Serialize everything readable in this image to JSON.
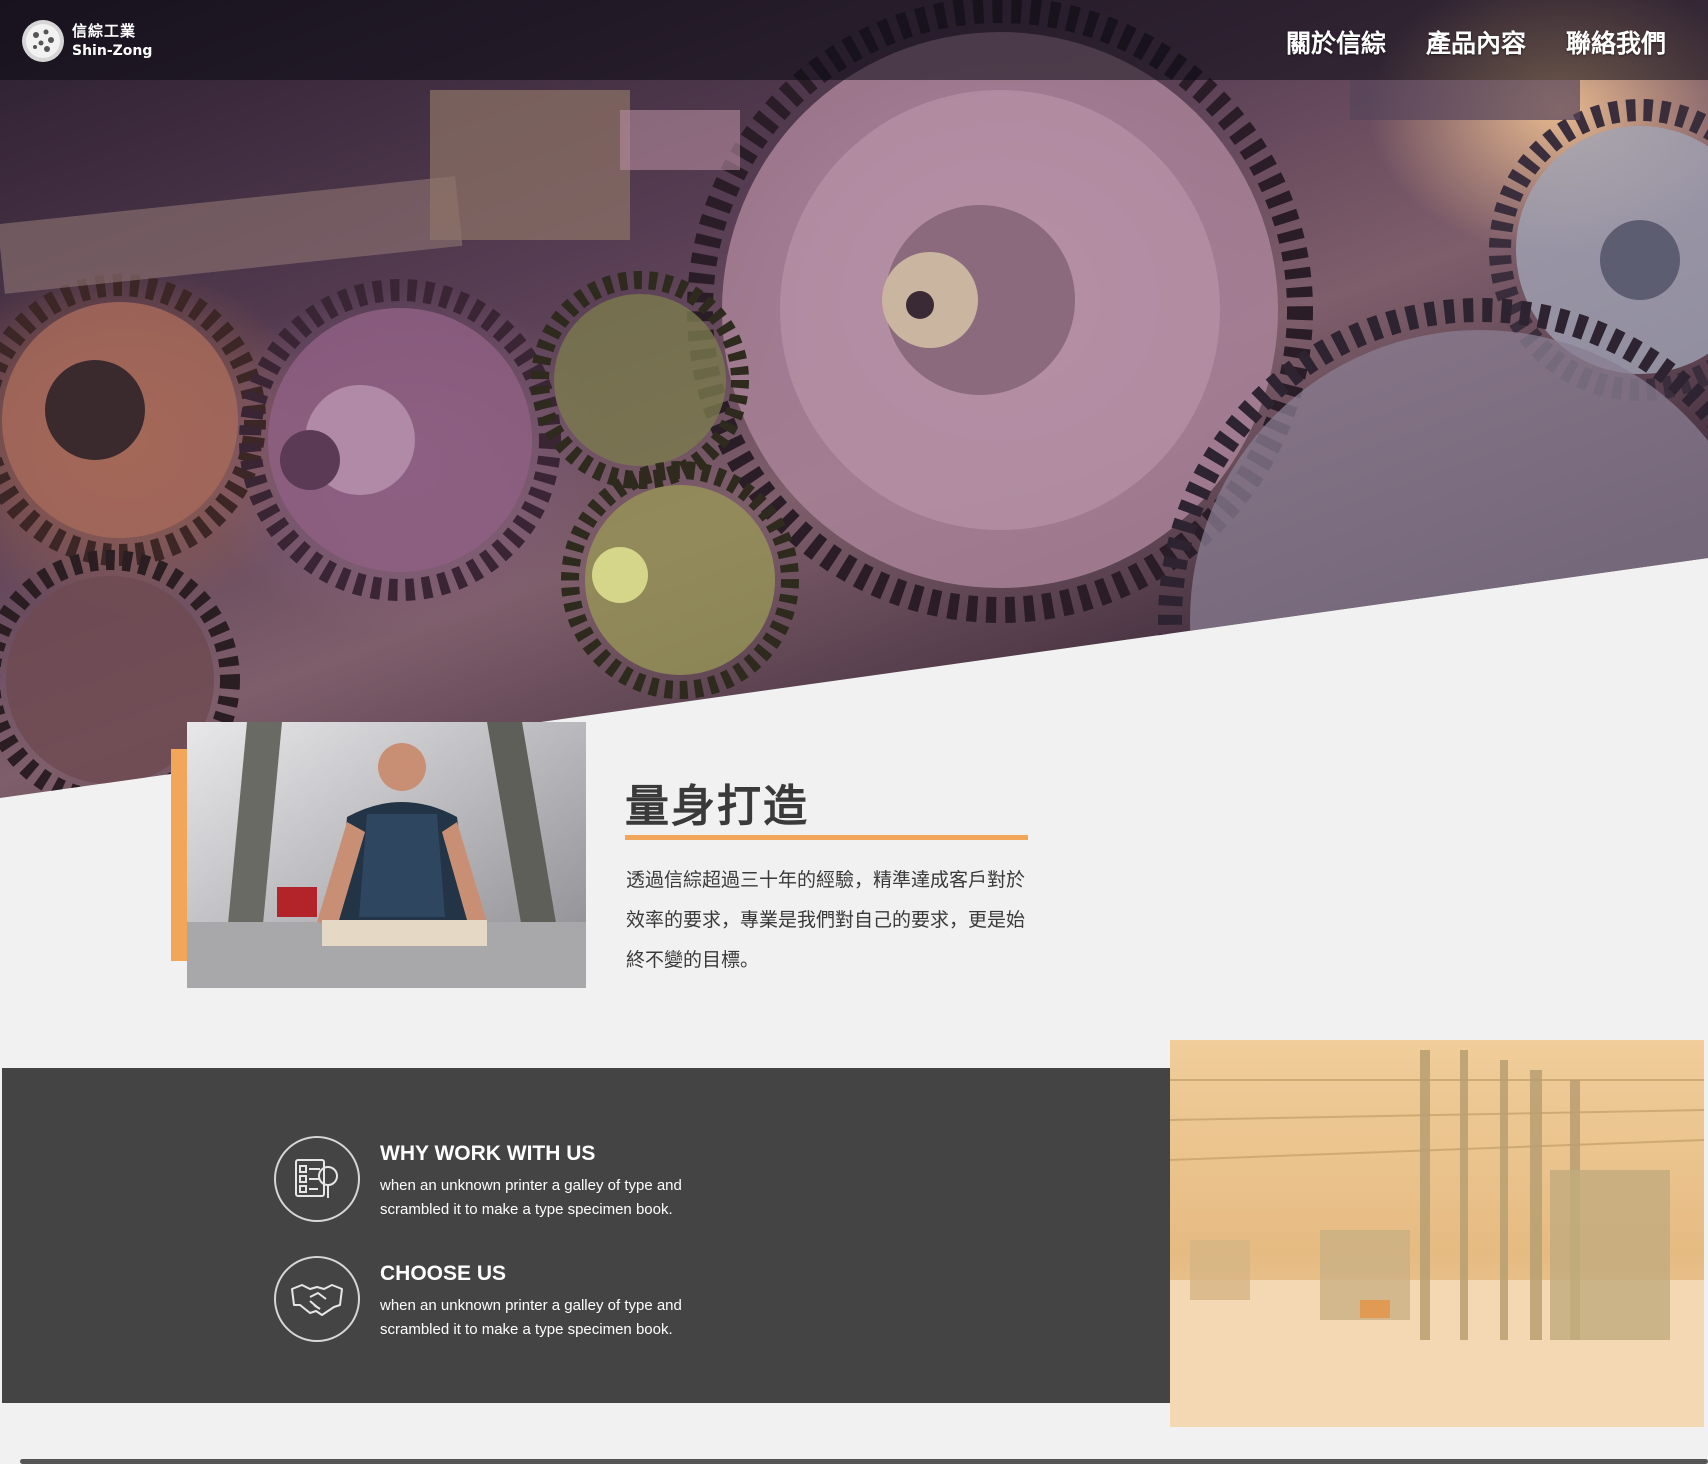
{
  "brand": {
    "name_cn": "信綜工業",
    "name_en": "Shin-Zong"
  },
  "nav": {
    "items": [
      {
        "label": "關於信綜"
      },
      {
        "label": "產品內容"
      },
      {
        "label": "聯絡我們"
      }
    ]
  },
  "hero": {
    "image_icon": "gears-machinery-image"
  },
  "feature": {
    "title": "量身打造",
    "body": "透過信綜超過三十年的經驗，精準達成客戶對於效率的要求，專業是我們對自己的要求，更是始終不變的目標。",
    "image_icon": "worker-photo",
    "accent_color": "#f2a65a"
  },
  "info": {
    "items": [
      {
        "title": "WHY WORK WITH US",
        "description": "when an unknown printer a galley of type and scrambled it to make a type specimen book.",
        "icon": "checklist-magnifier-icon"
      },
      {
        "title": "CHOOSE US",
        "description": "when an unknown printer a galley of type and scrambled it to make a type specimen book.",
        "icon": "handshake-icon"
      }
    ],
    "band_color": "#444444"
  },
  "factory": {
    "image_icon": "factory-interior-photo"
  }
}
